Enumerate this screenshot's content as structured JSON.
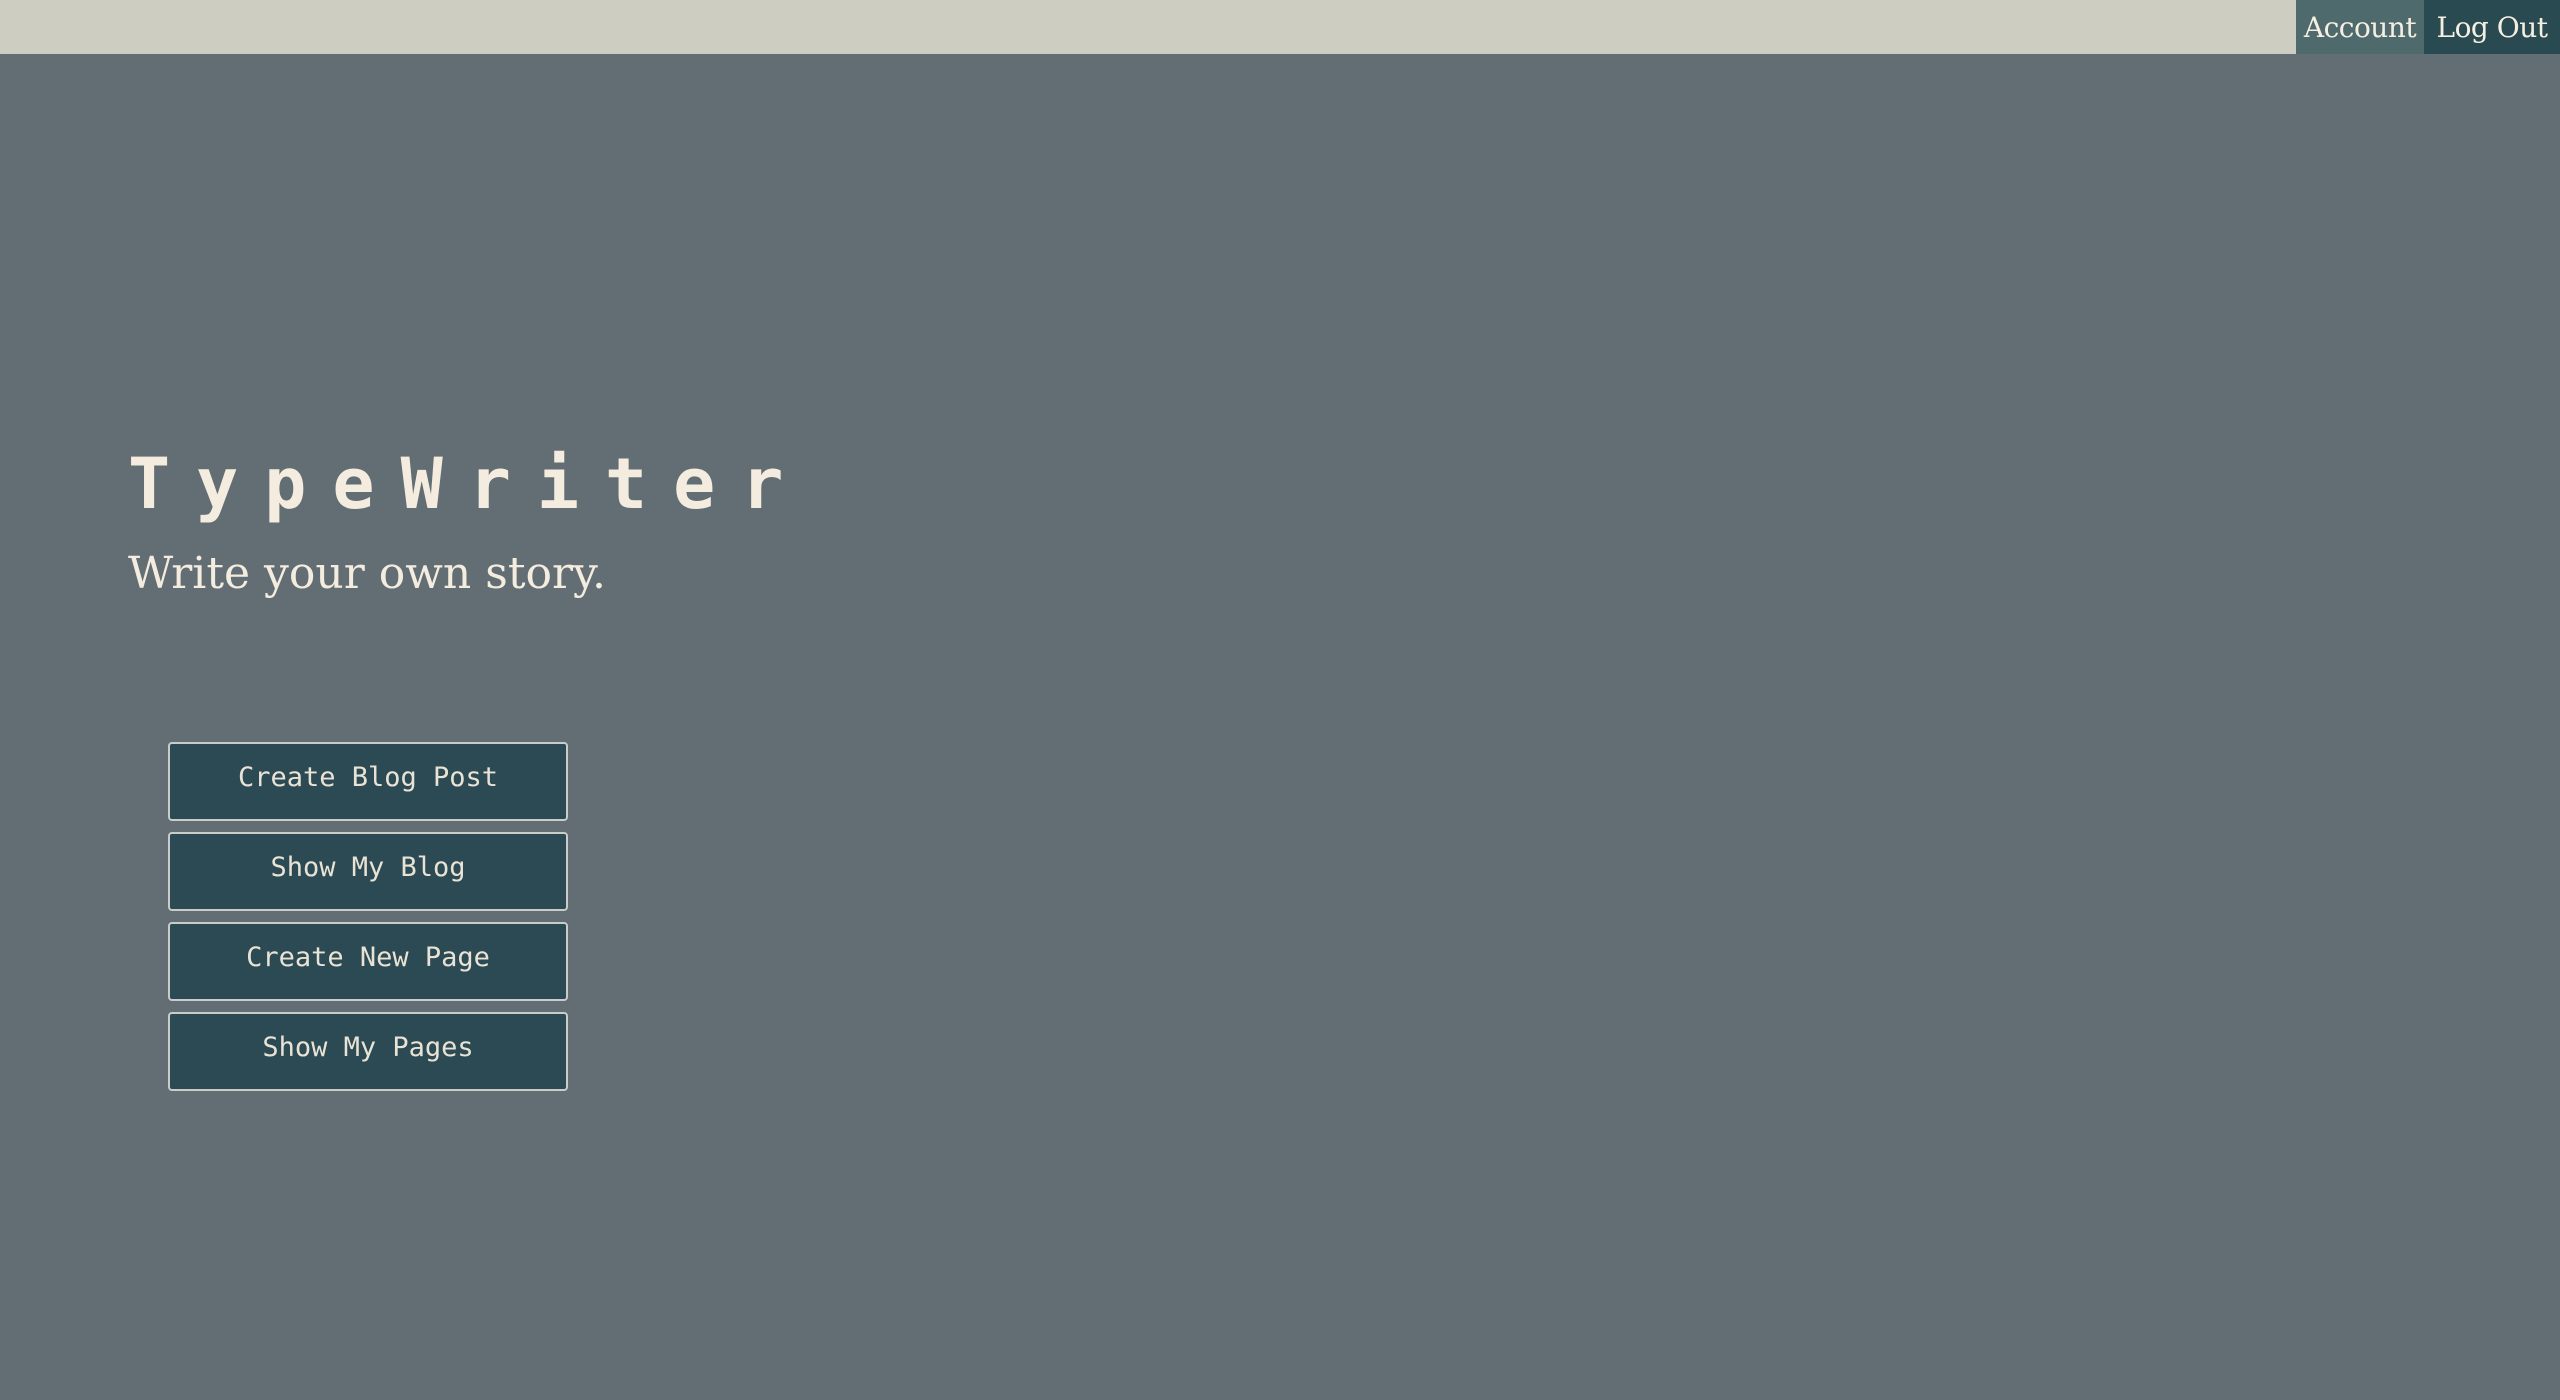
{
  "nav": {
    "account_label": "Account",
    "logout_label": "Log Out"
  },
  "hero": {
    "title": "TypeWriter",
    "tagline": "Write your own story."
  },
  "actions": [
    {
      "label": "Create Blog Post"
    },
    {
      "label": "Show My Blog"
    },
    {
      "label": "Create New Page"
    },
    {
      "label": "Show My Pages"
    }
  ],
  "colors": {
    "background": "#626d74",
    "topbar": "#cdcdc1",
    "account_tab": "#4e6a6c",
    "logout_tab": "#2a4a52",
    "button_fill": "#2b4a53",
    "text_cream": "#f4ecde"
  }
}
